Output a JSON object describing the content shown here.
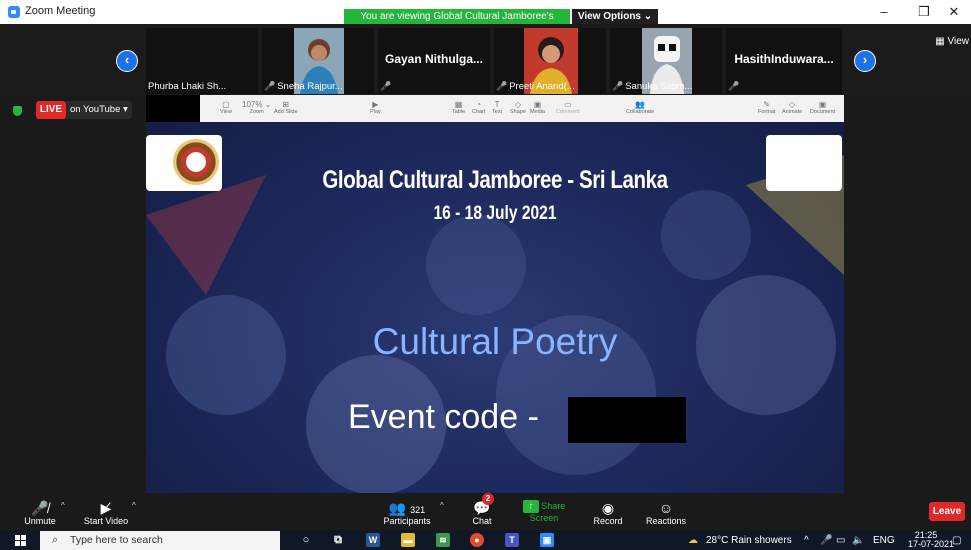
{
  "window": {
    "title": "Zoom Meeting"
  },
  "banner": {
    "viewing": "You are viewing Global Cultural Jamboree's screen",
    "view_options": "View Options ⌄"
  },
  "strip": {
    "participants": [
      {
        "name": "Phurba Lhaki Sh...",
        "muted": false
      },
      {
        "name": "Sneha Rajpur...",
        "muted": true
      },
      {
        "name": "Gayan  Nithulga...",
        "muted": true
      },
      {
        "name": "Preeti Anand(...",
        "muted": true
      },
      {
        "name": "Sanuka Sasm...",
        "muted": true
      },
      {
        "name": "HasithInduwara...",
        "muted": true
      }
    ],
    "view_label": "View"
  },
  "live": {
    "badge": "LIVE",
    "platform": "on YouTube ▾"
  },
  "share_toolbar": {
    "zoom": "107% ⌄",
    "items": [
      "View",
      "Zoom",
      "Add Slide",
      "Play",
      "Table",
      "Chart",
      "Text",
      "Shape",
      "Media",
      "Comment",
      "Collaborate",
      "Format",
      "Animate",
      "Document"
    ]
  },
  "slide": {
    "title": "Global Cultural Jamboree - Sri Lanka",
    "dates": "16 - 18 July 2021",
    "event": "Cultural Poetry",
    "code_label": "Event code -"
  },
  "controls": {
    "unmute": "Unmute",
    "start_video": "Start Video",
    "participants": "Participants",
    "participants_count": "321",
    "chat": "Chat",
    "chat_badge": "2",
    "share_screen": "Share Screen",
    "record": "Record",
    "reactions": "Reactions",
    "leave": "Leave"
  },
  "taskbar": {
    "search_placeholder": "Type here to search",
    "weather": "28°C  Rain showers",
    "lang": "ENG",
    "time": "21:25",
    "date": "17-07-2021"
  },
  "colors": {
    "accent_blue": "#2d8cff",
    "share_green": "#25b53a",
    "danger_red": "#e02828"
  }
}
